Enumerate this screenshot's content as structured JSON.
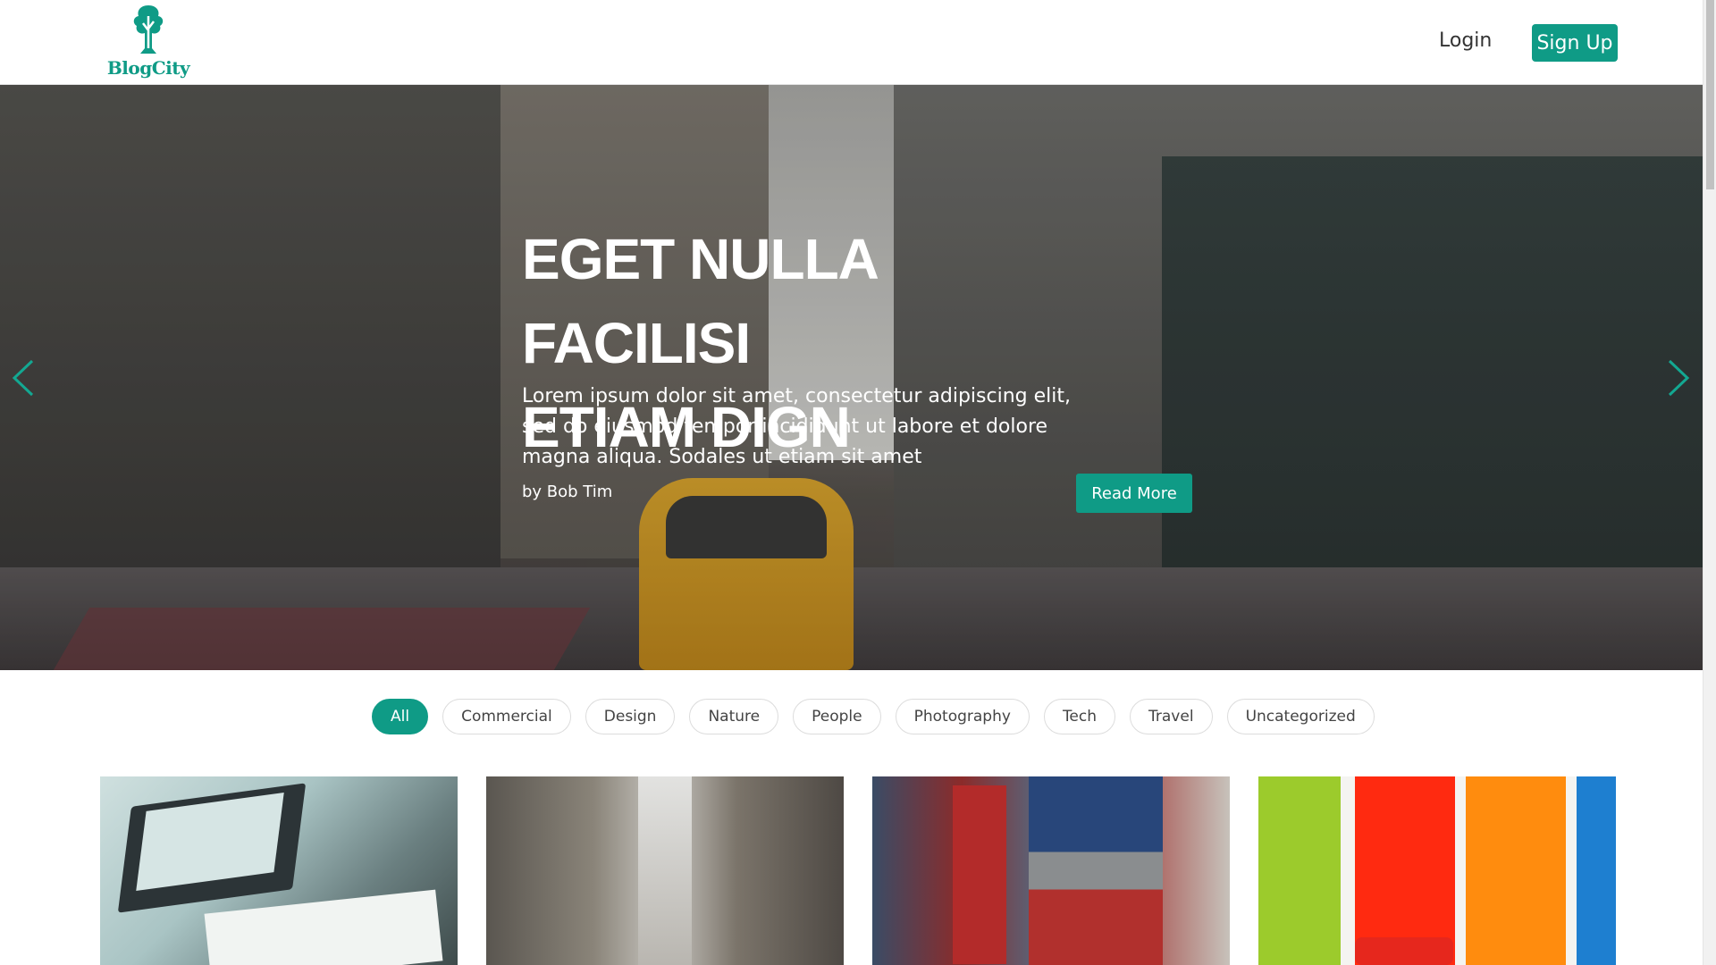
{
  "header": {
    "logo_text": "BlogCity",
    "login_label": "Login",
    "signup_label": "Sign Up"
  },
  "hero": {
    "title_line1": "EGET NULLA FACILISI",
    "title_line2": "ETIAM DIGN",
    "description": "Lorem ipsum dolor sit amet, consectetur adipiscing elit, sed do eiusmod tempor incididunt ut labore et dolore magna aliqua. Sodales ut etiam sit amet",
    "author": "by Bob Tim",
    "read_more_label": "Read More",
    "prev_icon": "chevron-left-icon",
    "next_icon": "chevron-right-icon"
  },
  "categories": [
    "All",
    "Commercial",
    "Design",
    "Nature",
    "People",
    "Photography",
    "Tech",
    "Travel",
    "Uncategorized"
  ],
  "active_category": "All",
  "colors": {
    "accent": "#0f9b86",
    "text": "#333333",
    "border": "#dcdcdc"
  }
}
